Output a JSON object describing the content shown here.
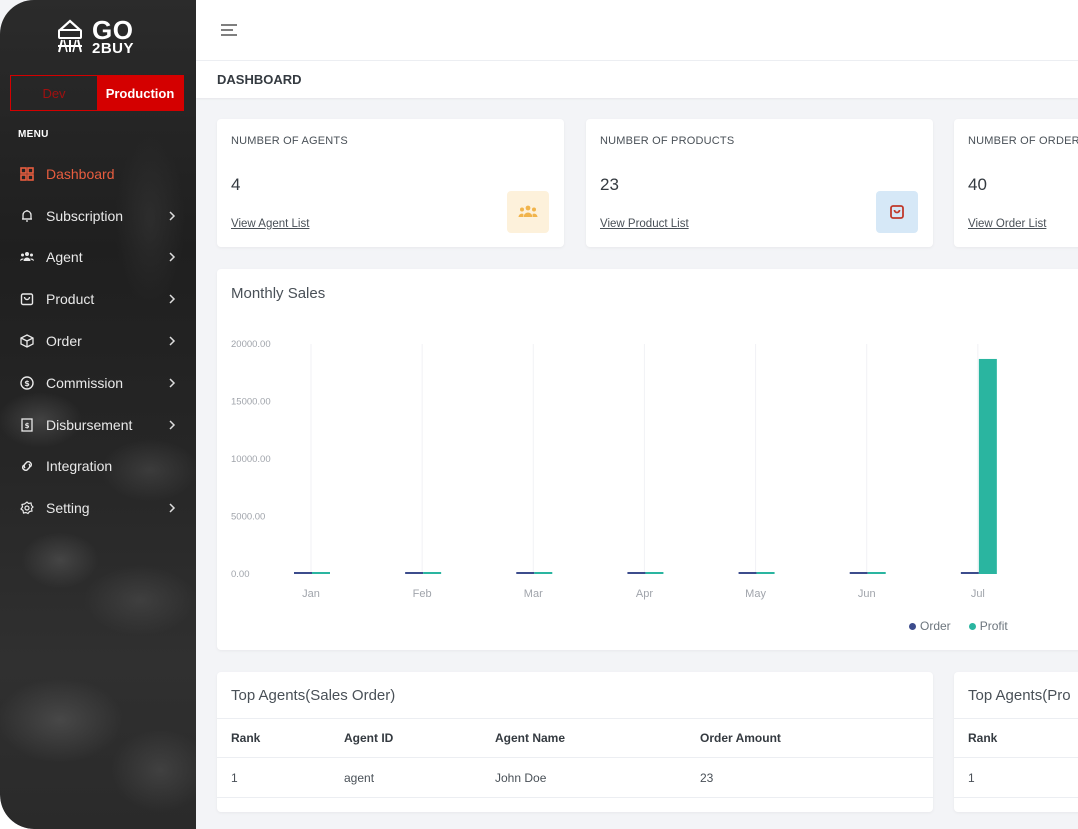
{
  "brand": {
    "go": "GO",
    "buy": "2BUY"
  },
  "env": {
    "dev": "Dev",
    "production": "Production"
  },
  "menu": {
    "title": "MENU",
    "items": [
      {
        "label": "Dashboard",
        "icon": "dashboard-icon"
      },
      {
        "label": "Subscription",
        "icon": "bell-icon"
      },
      {
        "label": "Agent",
        "icon": "users-icon"
      },
      {
        "label": "Product",
        "icon": "shopping-bag-icon"
      },
      {
        "label": "Order",
        "icon": "package-icon"
      },
      {
        "label": "Commission",
        "icon": "dollar-circle-icon"
      },
      {
        "label": "Disbursement",
        "icon": "receipt-icon"
      },
      {
        "label": "Integration",
        "icon": "link-icon"
      },
      {
        "label": "Setting",
        "icon": "gear-icon"
      }
    ]
  },
  "page": {
    "title": "DASHBOARD"
  },
  "stats": [
    {
      "label": "NUMBER OF AGENTS",
      "value": "4",
      "link": "View Agent List",
      "icon": "users-icon",
      "icon_color": "#f1b44c",
      "icon_bg": "#fdf1db"
    },
    {
      "label": "NUMBER OF PRODUCTS",
      "value": "23",
      "link": "View Product List",
      "icon": "shopping-bag-icon",
      "icon_color": "#c0392b",
      "icon_bg": "#d6e8f7"
    },
    {
      "label": "NUMBER OF ORDER",
      "value": "40",
      "link": "View Order List"
    }
  ],
  "chart": {
    "title": "Monthly Sales",
    "legend": [
      "Order",
      "Profit"
    ]
  },
  "chart_data": {
    "type": "bar",
    "title": "Monthly Sales",
    "categories": [
      "Jan",
      "Feb",
      "Mar",
      "Apr",
      "May",
      "Jun",
      "Jul"
    ],
    "ylim": [
      0,
      20000
    ],
    "yticks": [
      "20000.00",
      "15000.00",
      "10000.00",
      "5000.00",
      "0.00"
    ],
    "ytick_values": [
      20000,
      15000,
      10000,
      5000,
      0
    ],
    "series": [
      {
        "name": "Order",
        "color": "#3c4c8c",
        "values": [
          1,
          1,
          1,
          2,
          1,
          1,
          40
        ]
      },
      {
        "name": "Profit",
        "color": "#2ab5a0",
        "values": [
          0,
          0,
          20,
          40,
          0,
          30,
          18700
        ]
      }
    ],
    "legend_position": "bottom-right"
  },
  "top_sales": {
    "title": "Top Agents(Sales Order)",
    "columns": [
      "Rank",
      "Agent ID",
      "Agent Name",
      "Order Amount"
    ],
    "rows": [
      [
        "1",
        "agent",
        "John Doe",
        "23"
      ]
    ]
  },
  "top_profit": {
    "title": "Top Agents(Pro",
    "columns": [
      "Rank"
    ],
    "rows": [
      [
        "1"
      ]
    ]
  }
}
